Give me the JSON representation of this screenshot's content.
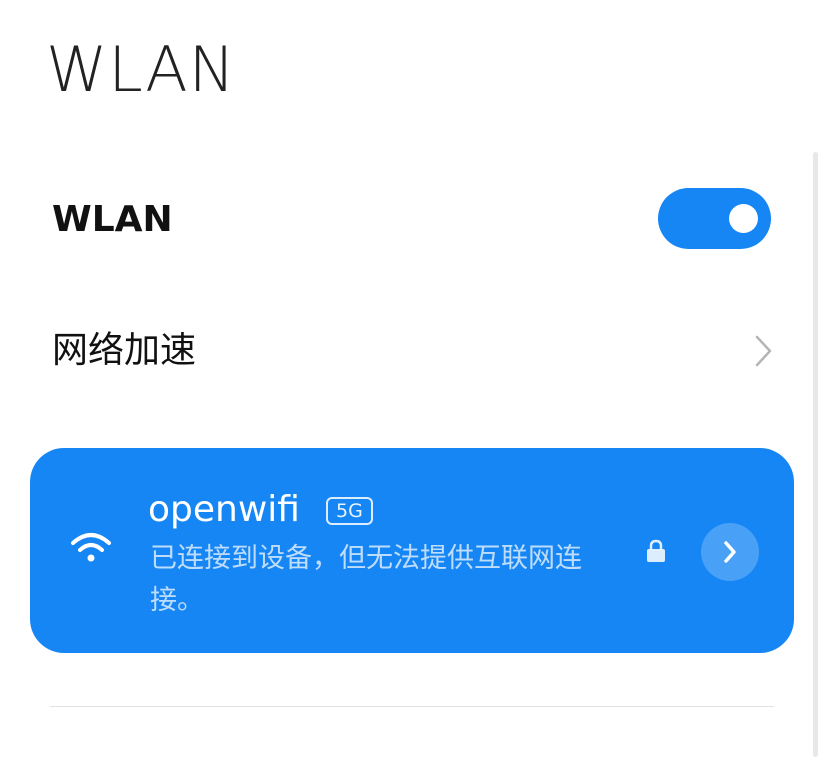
{
  "header": {
    "title": "WLAN"
  },
  "settings": {
    "wlan_toggle": {
      "label": "WLAN",
      "enabled": true
    },
    "network_acceleration": {
      "label": "网络加速",
      "icon": "chevron-right-icon"
    }
  },
  "connected_network": {
    "ssid": "openwifi",
    "band": "5G",
    "status": "已连接到设备，但无法提供互联网连接。",
    "secured": true,
    "signal_icon": "wifi-signal-icon",
    "lock_icon": "lock-icon",
    "detail_icon": "chevron-right-icon"
  },
  "colors": {
    "accent": "#1786f5",
    "background": "#ffffff"
  }
}
